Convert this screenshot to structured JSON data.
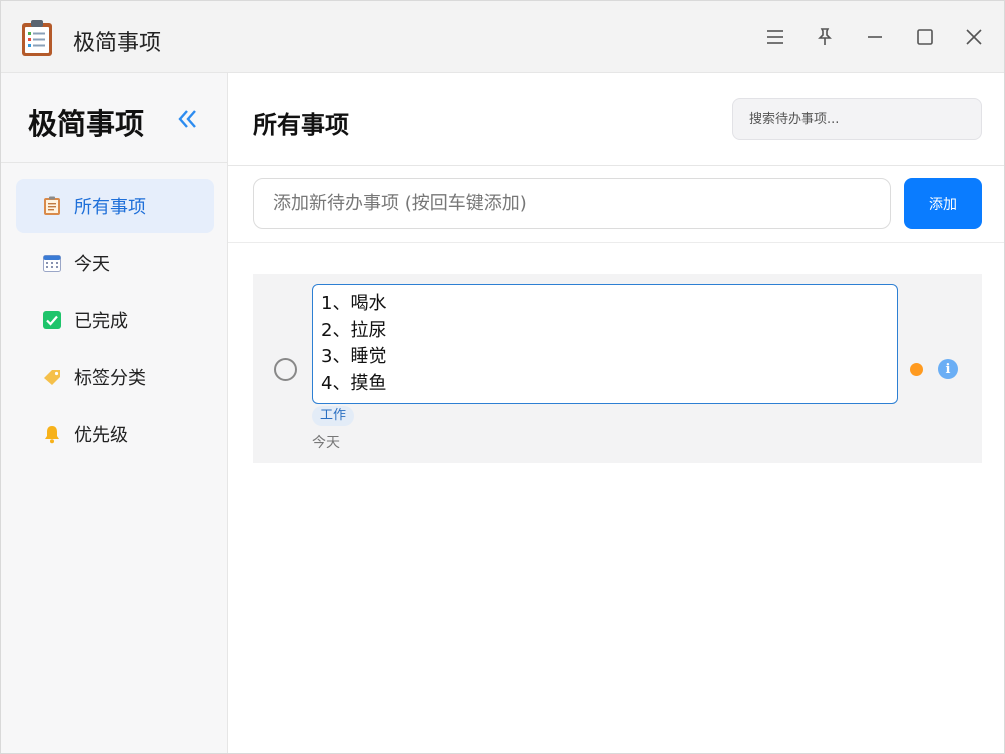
{
  "window": {
    "title": "极简事项"
  },
  "sidebar": {
    "title": "极简事项",
    "items": [
      {
        "label": "所有事项",
        "icon": "clipboard-icon",
        "active": true
      },
      {
        "label": "今天",
        "icon": "calendar-icon",
        "active": false
      },
      {
        "label": "已完成",
        "icon": "checkbox-icon",
        "active": false
      },
      {
        "label": "标签分类",
        "icon": "tag-icon",
        "active": false
      },
      {
        "label": "优先级",
        "icon": "bell-icon",
        "active": false
      }
    ]
  },
  "main": {
    "title": "所有事项",
    "search": {
      "placeholder": "搜索待办事项..."
    },
    "add": {
      "placeholder": "添加新待办事项 (按回车键添加)",
      "button_label": "添加"
    },
    "todos": [
      {
        "text": "1、喝水\n2、拉尿\n3、睡觉\n4、摸鱼",
        "tag": "工作",
        "date": "今天",
        "priority_color": "#ff9a1f",
        "info_symbol": "i"
      }
    ]
  },
  "colors": {
    "accent": "#0a7cff",
    "active_bg": "#e6eefb",
    "priority_medium": "#ff9a1f"
  }
}
